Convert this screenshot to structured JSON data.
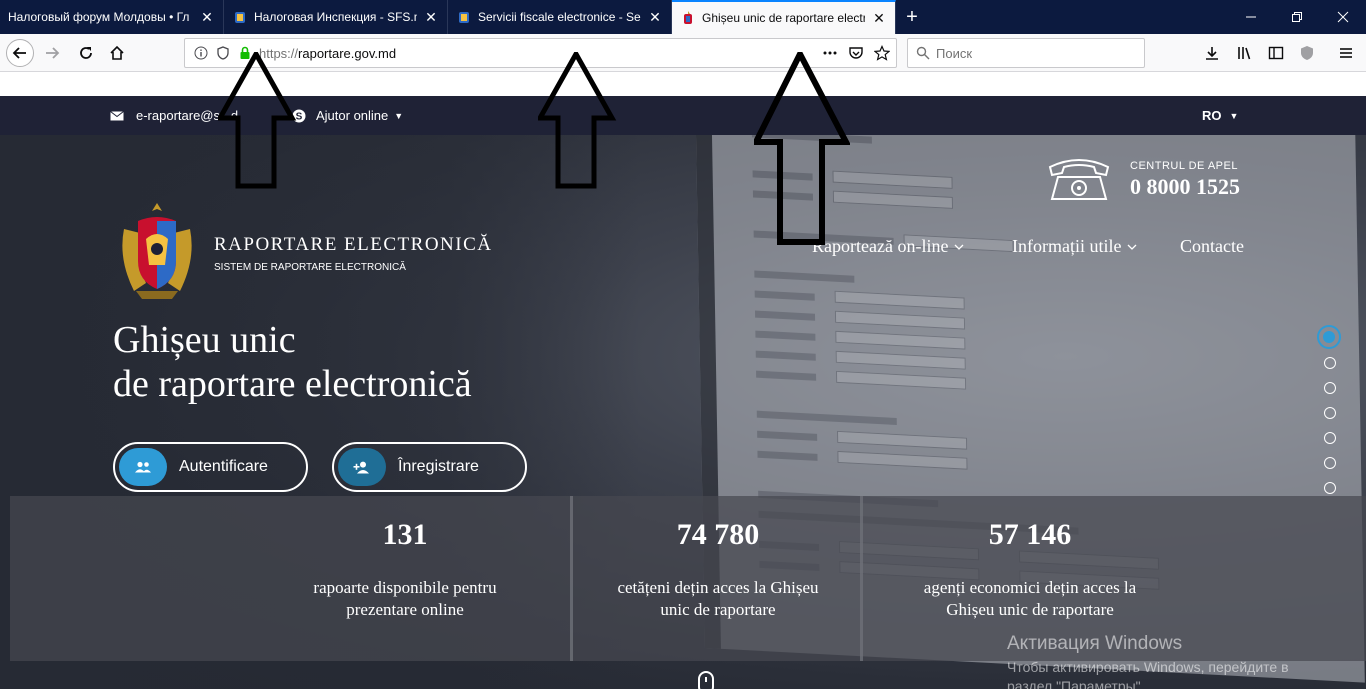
{
  "browser": {
    "tabs": [
      {
        "title": "Налоговый форум Молдовы • Гл",
        "active": false,
        "favicon": "none"
      },
      {
        "title": "Налоговая Инспекция - SFS.md",
        "active": false,
        "favicon": "coat-of-arms-icon"
      },
      {
        "title": "Servicii fiscale electronice - Servi",
        "active": false,
        "favicon": "coat-of-arms-icon"
      },
      {
        "title": "Ghișeu unic de raportare electron",
        "active": true,
        "favicon": "coat-of-arms-icon"
      }
    ],
    "close_glyph": "✕",
    "newtab_glyph": "+",
    "url_proto": "https://",
    "url_host": "raportare.gov.md",
    "search_placeholder": "Поиск",
    "url_right_icons": [
      "more-icon",
      "pocket-icon",
      "star-icon"
    ],
    "toolbar_icons": [
      "download-icon",
      "library-icon",
      "sidebar-icon",
      "shield-icon",
      "menu-icon"
    ]
  },
  "site": {
    "email": "e-raportare@s...d",
    "help": "Ajutor online",
    "lang": "RO",
    "title": "RAPORTARE ELECTRONICĂ",
    "subtitle": "SISTEM DE RAPORTARE ELECTRONICĂ",
    "call_label": "CENTRUL DE APEL",
    "call_number": "0 8000 1525",
    "menu": [
      {
        "label": "Raportează on-line",
        "has_dropdown": true
      },
      {
        "label": "Informații utile",
        "has_dropdown": true
      },
      {
        "label": "Contacte",
        "has_dropdown": false
      }
    ],
    "hero_line1": "Ghișeu unic",
    "hero_line2": "de raportare electronică",
    "btn_login": "Autentificare",
    "btn_register": "Înregistrare",
    "stats": [
      {
        "value": "131",
        "line1": "rapoarte disponibile pentru",
        "line2": "prezentare online"
      },
      {
        "value": "74 780",
        "line1": "cetățeni dețin acces la Ghișeu",
        "line2": "unic de raportare"
      },
      {
        "value": "57 146",
        "line1": "agenți economici dețin acces la",
        "line2": "Ghișeu unic de raportare"
      }
    ],
    "slider_dot_count": 7,
    "slider_active_index": 0
  },
  "os_overlay": {
    "title": "Активация Windows",
    "subtitle": "Чтобы активировать Windows, перейдите в раздел \"Параметры\"."
  },
  "colors": {
    "tabbar": "#0c1a3f",
    "accent": "#2e9bd6",
    "topstrip": "#1f2236"
  }
}
